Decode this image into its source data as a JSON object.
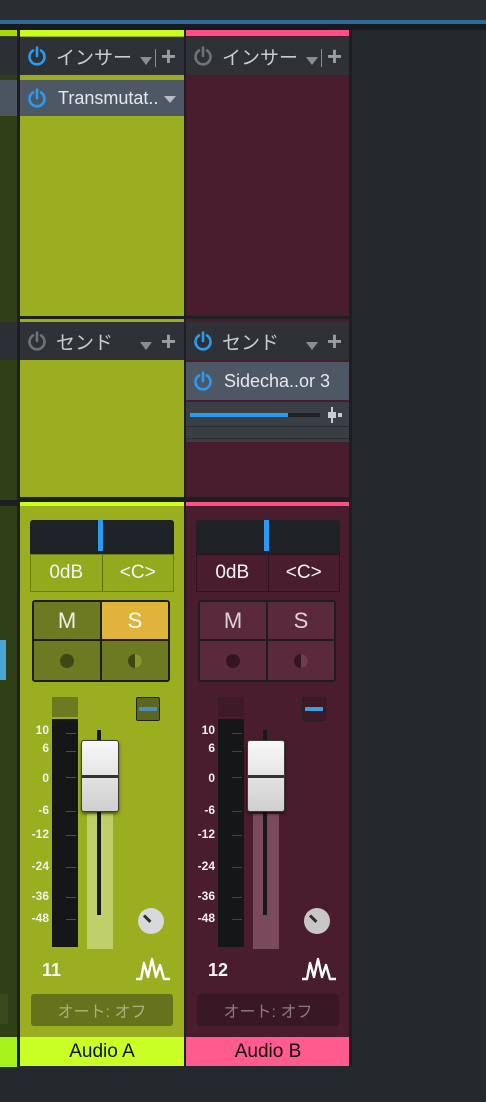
{
  "colors": {
    "channel_a_bg": "#99ad1f",
    "channel_a_accent": "#c6ff1a",
    "channel_a_name_bg": "#c9ff24",
    "channel_b_bg": "#4a1d2e",
    "channel_b_accent": "#ff4f86",
    "channel_b_name_bg": "#ff5b8e",
    "power_on": "#2a9bf0",
    "power_off": "#6f7277",
    "solo_active": "#e0b43a"
  },
  "channel_a": {
    "insert_header": "インサー",
    "insert_slot": "Transmutat..",
    "send_header": "センド",
    "volume": "0dB",
    "pan": "<C>",
    "pan_position_fraction": 0.5,
    "mute_label": "M",
    "solo_label": "S",
    "solo_active": true,
    "insert_power_on": true,
    "send_power_on": false,
    "number": "11",
    "automation": "オート: オフ",
    "name": "Audio A"
  },
  "channel_b": {
    "insert_header": "インサー",
    "send_header": "センド",
    "send_slot": "Sidecha..or 3",
    "send_level_fraction": 0.75,
    "volume": "0dB",
    "pan": "<C>",
    "pan_position_fraction": 0.5,
    "mute_label": "M",
    "solo_label": "S",
    "solo_active": false,
    "insert_power_on": false,
    "send_power_on": true,
    "number": "12",
    "automation": "オート: オフ",
    "name": "Audio B"
  },
  "meter_scale": [
    "10",
    "6",
    "0",
    "-6",
    "-12",
    "-24",
    "-36",
    "-48"
  ],
  "icons": {
    "power": "power-icon",
    "add": "plus-icon",
    "dropdown": "chevron-down-icon",
    "record": "record-arm-icon",
    "monitor": "monitor-icon",
    "knob": "pan-knob-icon",
    "fx": "waveform-icon",
    "expand": "meter-toggle-icon"
  }
}
